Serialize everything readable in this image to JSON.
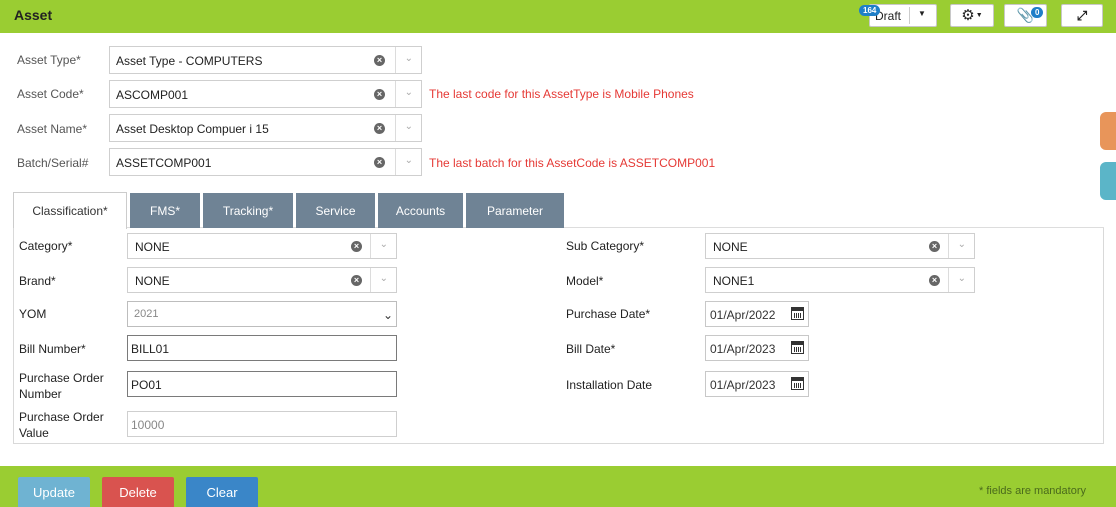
{
  "header": {
    "title": "Asset",
    "status_label": "Draft",
    "status_badge": "164",
    "attachment_badge": "0"
  },
  "form": {
    "asset_type": {
      "label": "Asset Type*",
      "value": "Asset Type - COMPUTERS"
    },
    "asset_code": {
      "label": "Asset Code*",
      "value": "ASCOMP001",
      "message": "The last code for this AssetType is Mobile Phones"
    },
    "asset_name": {
      "label": "Asset Name*",
      "value": "Asset Desktop Compuer i 15"
    },
    "batch_serial": {
      "label": "Batch/Serial#",
      "value": "ASSETCOMP001",
      "message": "The last batch for this AssetCode is ASSETCOMP001"
    }
  },
  "tabs": [
    "Classification*",
    "FMS*",
    "Tracking*",
    "Service",
    "Accounts",
    "Parameter"
  ],
  "classification": {
    "category": {
      "label": "Category*",
      "value": "NONE"
    },
    "brand": {
      "label": "Brand*",
      "value": "NONE"
    },
    "yom": {
      "label": "YOM",
      "value": "2021"
    },
    "bill_number": {
      "label": "Bill Number*",
      "value": "BILL01"
    },
    "po_number": {
      "label": "Purchase Order Number",
      "value": "PO01"
    },
    "po_value": {
      "label": "Purchase Order Value",
      "value": "10000"
    },
    "sub_category": {
      "label": "Sub Category*",
      "value": "NONE"
    },
    "model": {
      "label": "Model*",
      "value": "NONE1"
    },
    "purchase_date": {
      "label": "Purchase Date*",
      "value": "01/Apr/2022"
    },
    "bill_date": {
      "label": "Bill Date*",
      "value": "01/Apr/2023"
    },
    "installation_date": {
      "label": "Installation Date",
      "value": "01/Apr/2023"
    }
  },
  "footer": {
    "update_label": "Update",
    "delete_label": "Delete",
    "clear_label": "Clear",
    "mandatory_note": "* fields are mandatory"
  },
  "colors": {
    "bar": "#9acd32",
    "tab": "#6f8395",
    "error": "#e53935",
    "update": "#6fb3d2",
    "delete": "#d9534f",
    "clear": "#3a86c8",
    "side_tab_orange": "#e8955a",
    "side_tab_teal": "#5bb5c8"
  }
}
